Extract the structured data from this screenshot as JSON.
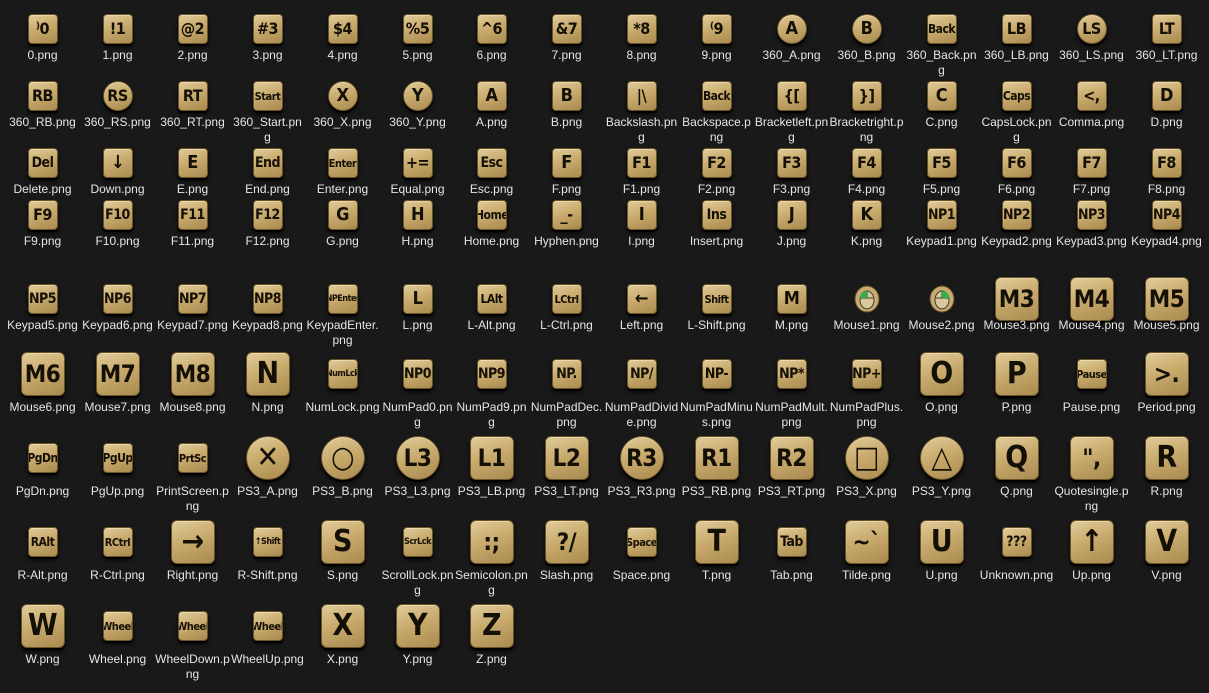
{
  "files": [
    {
      "name": "0.png",
      "glyph": "⁾0"
    },
    {
      "name": "1.png",
      "glyph": "!1"
    },
    {
      "name": "2.png",
      "glyph": "@2"
    },
    {
      "name": "3.png",
      "glyph": "#3"
    },
    {
      "name": "4.png",
      "glyph": "$4"
    },
    {
      "name": "5.png",
      "glyph": "%5"
    },
    {
      "name": "6.png",
      "glyph": "^6"
    },
    {
      "name": "7.png",
      "glyph": "&7"
    },
    {
      "name": "8.png",
      "glyph": "*8"
    },
    {
      "name": "9.png",
      "glyph": "⁽9"
    },
    {
      "name": "360_A.png",
      "glyph": "A",
      "shape": "round"
    },
    {
      "name": "360_B.png",
      "glyph": "B",
      "shape": "round"
    },
    {
      "name": "360_Back.png",
      "glyph": "Back"
    },
    {
      "name": "360_LB.png",
      "glyph": "LB"
    },
    {
      "name": "360_LS.png",
      "glyph": "LS",
      "shape": "round"
    },
    {
      "name": "360_LT.png",
      "glyph": "LT"
    },
    {
      "name": "360_RB.png",
      "glyph": "RB"
    },
    {
      "name": "360_RS.png",
      "glyph": "RS",
      "shape": "round"
    },
    {
      "name": "360_RT.png",
      "glyph": "RT"
    },
    {
      "name": "360_Start.png",
      "glyph": "Start"
    },
    {
      "name": "360_X.png",
      "glyph": "X",
      "shape": "round"
    },
    {
      "name": "360_Y.png",
      "glyph": "Y",
      "shape": "round"
    },
    {
      "name": "A.png",
      "glyph": "A"
    },
    {
      "name": "B.png",
      "glyph": "B"
    },
    {
      "name": "Backslash.png",
      "glyph": "|\\"
    },
    {
      "name": "Backspace.png",
      "glyph": "Back"
    },
    {
      "name": "Bracketleft.png",
      "glyph": "{["
    },
    {
      "name": "Bracketright.png",
      "glyph": "}]"
    },
    {
      "name": "C.png",
      "glyph": "C"
    },
    {
      "name": "CapsLock.png",
      "glyph": "Caps"
    },
    {
      "name": "Comma.png",
      "glyph": "<,"
    },
    {
      "name": "D.png",
      "glyph": "D"
    },
    {
      "name": "Delete.png",
      "glyph": "Del"
    },
    {
      "name": "Down.png",
      "glyph": "↓"
    },
    {
      "name": "E.png",
      "glyph": "E"
    },
    {
      "name": "End.png",
      "glyph": "End"
    },
    {
      "name": "Enter.png",
      "glyph": "Enter"
    },
    {
      "name": "Equal.png",
      "glyph": "+="
    },
    {
      "name": "Esc.png",
      "glyph": "Esc"
    },
    {
      "name": "F.png",
      "glyph": "F"
    },
    {
      "name": "F1.png",
      "glyph": "F1"
    },
    {
      "name": "F2.png",
      "glyph": "F2"
    },
    {
      "name": "F3.png",
      "glyph": "F3"
    },
    {
      "name": "F4.png",
      "glyph": "F4"
    },
    {
      "name": "F5.png",
      "glyph": "F5"
    },
    {
      "name": "F6.png",
      "glyph": "F6"
    },
    {
      "name": "F7.png",
      "glyph": "F7"
    },
    {
      "name": "F8.png",
      "glyph": "F8"
    },
    {
      "name": "F9.png",
      "glyph": "F9"
    },
    {
      "name": "F10.png",
      "glyph": "F10"
    },
    {
      "name": "F11.png",
      "glyph": "F11"
    },
    {
      "name": "F12.png",
      "glyph": "F12"
    },
    {
      "name": "G.png",
      "glyph": "G"
    },
    {
      "name": "H.png",
      "glyph": "H"
    },
    {
      "name": "Home.png",
      "glyph": "Home"
    },
    {
      "name": "Hyphen.png",
      "glyph": "_-"
    },
    {
      "name": "I.png",
      "glyph": "I"
    },
    {
      "name": "Insert.png",
      "glyph": "Ins"
    },
    {
      "name": "J.png",
      "glyph": "J"
    },
    {
      "name": "K.png",
      "glyph": "K"
    },
    {
      "name": "Keypad1.png",
      "glyph": "NP1"
    },
    {
      "name": "Keypad2.png",
      "glyph": "NP2"
    },
    {
      "name": "Keypad3.png",
      "glyph": "NP3"
    },
    {
      "name": "Keypad4.png",
      "glyph": "NP4"
    },
    {
      "name": "Keypad5.png",
      "glyph": "NP5"
    },
    {
      "name": "Keypad6.png",
      "glyph": "NP6"
    },
    {
      "name": "Keypad7.png",
      "glyph": "NP7"
    },
    {
      "name": "Keypad8.png",
      "glyph": "NP8"
    },
    {
      "name": "KeypadEnter.png",
      "glyph": "NPEnter"
    },
    {
      "name": "L.png",
      "glyph": "L"
    },
    {
      "name": "L-Alt.png",
      "glyph": "LAlt"
    },
    {
      "name": "L-Ctrl.png",
      "glyph": "LCtrl"
    },
    {
      "name": "Left.png",
      "glyph": "←"
    },
    {
      "name": "L-Shift.png",
      "glyph": "Shift"
    },
    {
      "name": "M.png",
      "glyph": "M"
    },
    {
      "name": "Mouse1.png",
      "glyph": "mouse-left",
      "shape": "mouse"
    },
    {
      "name": "Mouse2.png",
      "glyph": "mouse-right",
      "shape": "mouse"
    },
    {
      "name": "Mouse3.png",
      "glyph": "M3",
      "size": "lg"
    },
    {
      "name": "Mouse4.png",
      "glyph": "M4",
      "size": "lg"
    },
    {
      "name": "Mouse5.png",
      "glyph": "M5",
      "size": "lg"
    },
    {
      "name": "Mouse6.png",
      "glyph": "M6",
      "size": "lg"
    },
    {
      "name": "Mouse7.png",
      "glyph": "M7",
      "size": "lg"
    },
    {
      "name": "Mouse8.png",
      "glyph": "M8",
      "size": "lg"
    },
    {
      "name": "N.png",
      "glyph": "N",
      "size": "lg"
    },
    {
      "name": "NumLock.png",
      "glyph": "NumLck"
    },
    {
      "name": "NumPad0.png",
      "glyph": "NP0"
    },
    {
      "name": "NumPad9.png",
      "glyph": "NP9"
    },
    {
      "name": "NumPadDec.png",
      "glyph": "NP."
    },
    {
      "name": "NumPadDivide.png",
      "glyph": "NP/"
    },
    {
      "name": "NumPadMinus.png",
      "glyph": "NP-"
    },
    {
      "name": "NumPadMult.png",
      "glyph": "NP*"
    },
    {
      "name": "NumPadPlus.png",
      "glyph": "NP+"
    },
    {
      "name": "O.png",
      "glyph": "O",
      "size": "lg"
    },
    {
      "name": "P.png",
      "glyph": "P",
      "size": "lg"
    },
    {
      "name": "Pause.png",
      "glyph": "Pause"
    },
    {
      "name": "Period.png",
      "glyph": ">.",
      "size": "lg"
    },
    {
      "name": "PgDn.png",
      "glyph": "PgDn"
    },
    {
      "name": "PgUp.png",
      "glyph": "PgUp"
    },
    {
      "name": "PrintScreen.png",
      "glyph": "PrtSc"
    },
    {
      "name": "PS3_A.png",
      "glyph": "✕",
      "size": "lg",
      "shape": "round"
    },
    {
      "name": "PS3_B.png",
      "glyph": "○",
      "size": "lg",
      "shape": "round"
    },
    {
      "name": "PS3_L3.png",
      "glyph": "L3",
      "size": "lg",
      "shape": "round"
    },
    {
      "name": "PS3_LB.png",
      "glyph": "L1",
      "size": "lg"
    },
    {
      "name": "PS3_LT.png",
      "glyph": "L2",
      "size": "lg"
    },
    {
      "name": "PS3_R3.png",
      "glyph": "R3",
      "size": "lg",
      "shape": "round"
    },
    {
      "name": "PS3_RB.png",
      "glyph": "R1",
      "size": "lg"
    },
    {
      "name": "PS3_RT.png",
      "glyph": "R2",
      "size": "lg"
    },
    {
      "name": "PS3_X.png",
      "glyph": "□",
      "size": "lg",
      "shape": "round"
    },
    {
      "name": "PS3_Y.png",
      "glyph": "△",
      "size": "lg",
      "shape": "round"
    },
    {
      "name": "Q.png",
      "glyph": "Q",
      "size": "lg"
    },
    {
      "name": "Quotesingle.png",
      "glyph": "\",",
      "size": "lg"
    },
    {
      "name": "R.png",
      "glyph": "R",
      "size": "lg"
    },
    {
      "name": "R-Alt.png",
      "glyph": "RAlt"
    },
    {
      "name": "R-Ctrl.png",
      "glyph": "RCtrl"
    },
    {
      "name": "Right.png",
      "glyph": "→",
      "size": "lg"
    },
    {
      "name": "R-Shift.png",
      "glyph": "↑Shift"
    },
    {
      "name": "S.png",
      "glyph": "S",
      "size": "lg"
    },
    {
      "name": "ScrollLock.png",
      "glyph": "ScrLck"
    },
    {
      "name": "Semicolon.png",
      "glyph": ":;",
      "size": "lg"
    },
    {
      "name": "Slash.png",
      "glyph": "?/",
      "size": "lg"
    },
    {
      "name": "Space.png",
      "glyph": "Space"
    },
    {
      "name": "T.png",
      "glyph": "T",
      "size": "lg"
    },
    {
      "name": "Tab.png",
      "glyph": "Tab"
    },
    {
      "name": "Tilde.png",
      "glyph": "~`",
      "size": "lg"
    },
    {
      "name": "U.png",
      "glyph": "U",
      "size": "lg"
    },
    {
      "name": "Unknown.png",
      "glyph": "???"
    },
    {
      "name": "Up.png",
      "glyph": "↑",
      "size": "lg"
    },
    {
      "name": "V.png",
      "glyph": "V",
      "size": "lg"
    },
    {
      "name": "W.png",
      "glyph": "W",
      "size": "lg"
    },
    {
      "name": "Wheel.png",
      "glyph": "Wheel"
    },
    {
      "name": "WheelDown.png",
      "glyph": "Wheel"
    },
    {
      "name": "WheelUp.png",
      "glyph": "Wheel"
    },
    {
      "name": "X.png",
      "glyph": "X",
      "size": "lg"
    },
    {
      "name": "Y.png",
      "glyph": "Y",
      "size": "lg"
    },
    {
      "name": "Z.png",
      "glyph": "Z",
      "size": "lg"
    }
  ]
}
